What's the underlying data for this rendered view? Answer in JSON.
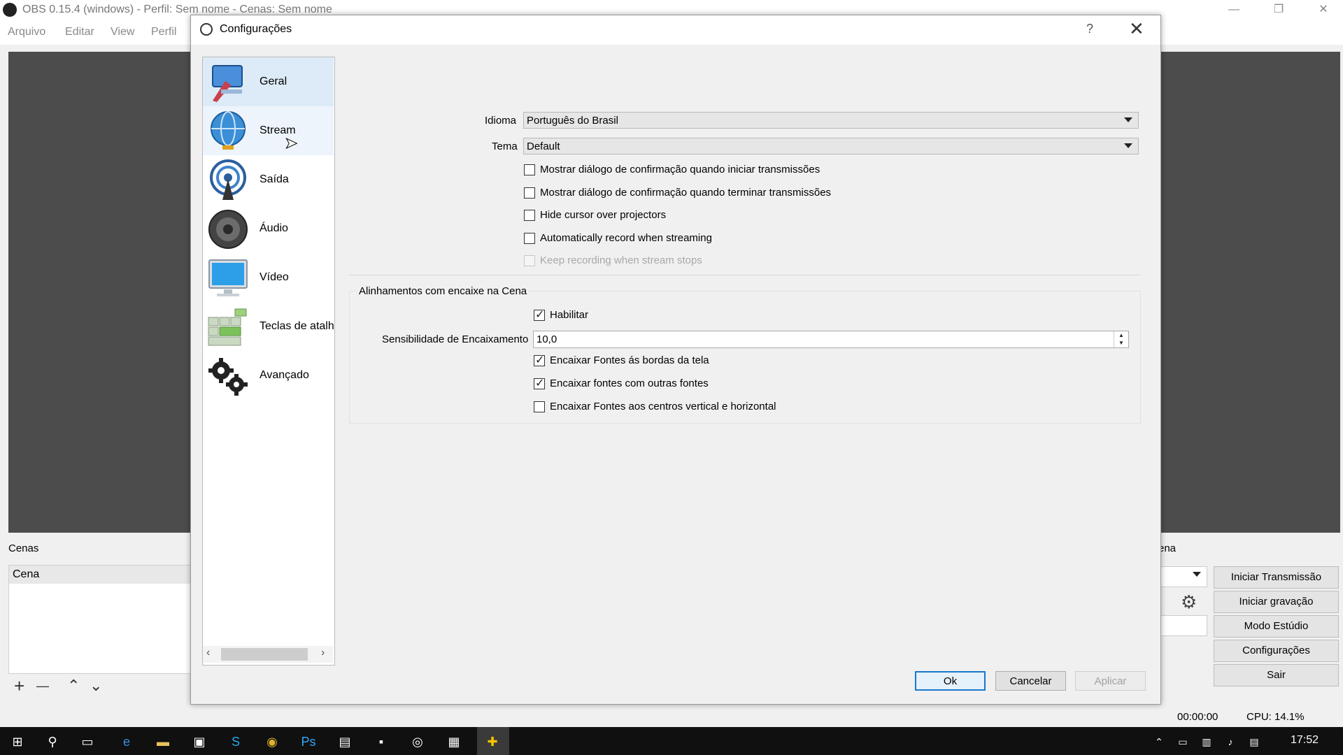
{
  "main_window": {
    "title": "OBS 0.15.4 (windows) - Perfil: Sem nome - Cenas: Sem nome",
    "controls": [
      "—",
      "❐",
      "✕"
    ],
    "menu": [
      "Arquivo",
      "Editar",
      "View",
      "Perfil"
    ],
    "scenes_label": "Cenas",
    "scene_item": "Cena",
    "scene_tools": [
      "+",
      "—",
      "⌃",
      "⌄"
    ],
    "mixer_label_partial": "ena",
    "buttons": [
      "Iniciar Transmissão",
      "Iniciar gravação",
      "Modo Estúdio",
      "Configurações",
      "Sair"
    ],
    "status_time": "00:00:00",
    "status_cpu": "CPU: 14.1%"
  },
  "dialog": {
    "title": "Configurações",
    "help": "?",
    "close": "✕",
    "nav": [
      {
        "label": "Geral",
        "icon": "general-icon"
      },
      {
        "label": "Stream",
        "icon": "stream-globe-icon"
      },
      {
        "label": "Saída",
        "icon": "output-broadcast-icon"
      },
      {
        "label": "Áudio",
        "icon": "speaker-icon"
      },
      {
        "label": "Vídeo",
        "icon": "monitor-icon"
      },
      {
        "label": "Teclas de atalh",
        "icon": "hotkeys-keyboard-icon"
      },
      {
        "label": "Avançado",
        "icon": "gears-icon"
      }
    ],
    "general": {
      "language_label": "Idioma",
      "language_value": "Português do Brasil",
      "theme_label": "Tema",
      "theme_value": "Default",
      "checkboxes": [
        {
          "label": "Mostrar diálogo de confirmação quando iniciar transmissões",
          "checked": false,
          "enabled": true
        },
        {
          "label": "Mostrar diálogo de confirmação quando terminar transmissões",
          "checked": false,
          "enabled": true
        },
        {
          "label": "Hide cursor over projectors",
          "checked": false,
          "enabled": true
        },
        {
          "label": "Automatically record when streaming",
          "checked": false,
          "enabled": true
        },
        {
          "label": "Keep recording when stream stops",
          "checked": false,
          "enabled": false
        }
      ]
    },
    "snapping": {
      "group_title": "Alinhamentos com encaixe na Cena",
      "enable_label": "Habilitar",
      "enable_checked": true,
      "sensitivity_label": "Sensibilidade de Encaixamento",
      "sensitivity_value": "10,0",
      "options": [
        {
          "label": "Encaixar Fontes ás bordas da tela",
          "checked": true
        },
        {
          "label": "Encaixar fontes com outras fontes",
          "checked": true
        },
        {
          "label": "Encaixar Fontes aos centros vertical e horizontal",
          "checked": false
        }
      ]
    },
    "buttons": {
      "ok": "Ok",
      "cancel": "Cancelar",
      "apply": "Aplicar"
    }
  },
  "taskbar": {
    "time": "17:52"
  },
  "colors": {
    "selection": "#dcebf7",
    "ok_border": "#1979ca",
    "preview_bg": "#4c4c4c"
  }
}
